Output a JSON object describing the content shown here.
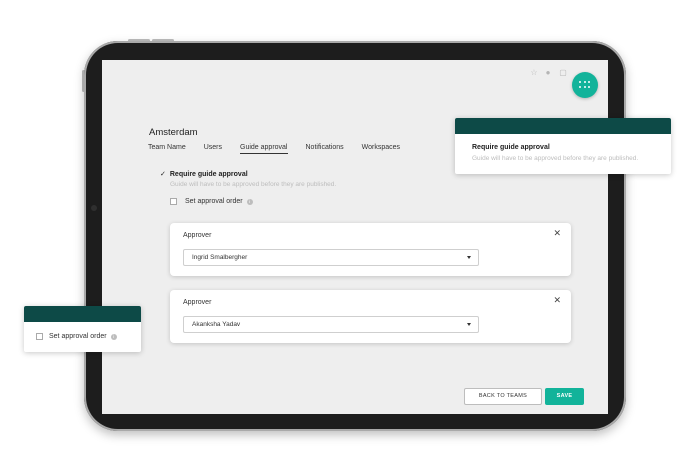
{
  "team": {
    "name": "Amsterdam"
  },
  "tabs": [
    {
      "label": "Team Name",
      "active": false
    },
    {
      "label": "Users",
      "active": false
    },
    {
      "label": "Guide approval",
      "active": true
    },
    {
      "label": "Notifications",
      "active": false
    },
    {
      "label": "Workspaces",
      "active": false
    }
  ],
  "settings": {
    "require_label": "Require guide approval",
    "require_checked": true,
    "require_desc": "Guide will have to be approved before they are published.",
    "order_label": "Set approval order",
    "order_checked": false
  },
  "approvers": [
    {
      "title": "Approver",
      "value": "Ingrid Smalbergher"
    },
    {
      "title": "Approver",
      "value": "Akanksha Yadav"
    }
  ],
  "actions": {
    "back_label": "BACK TO TEAMS",
    "save_label": "SAVE"
  },
  "icons": {
    "header": [
      "star-icon",
      "user-icon",
      "chat-icon"
    ],
    "fab": "apps-grid-icon",
    "close": "close-icon",
    "info": "info-icon"
  },
  "colors": {
    "accent": "#12b39a",
    "callout_header": "#0d4a47"
  },
  "callout_right": {
    "title": "Require guide approval",
    "desc": "Guide will have to be approved before they are published."
  },
  "callout_left": {
    "label": "Set approval order"
  }
}
